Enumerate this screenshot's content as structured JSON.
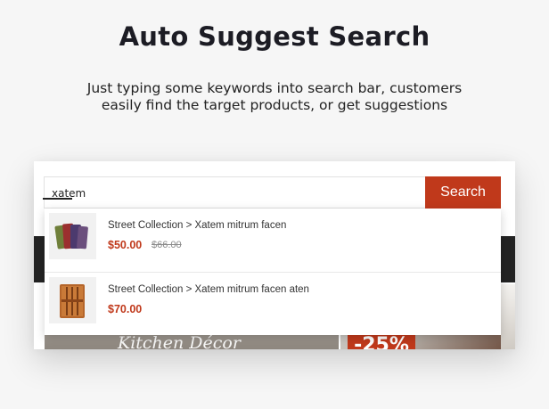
{
  "heading": "Auto Suggest Search",
  "description": "Just typing some keywords into search bar, customers easily find the target products, or get suggestions",
  "search": {
    "value": "xatem",
    "button_label": "Search"
  },
  "results": [
    {
      "name": "Street Collection > Xatem mitrum facen",
      "price": "$50.00",
      "old_price": "$66.00"
    },
    {
      "name": "Street Collection > Xatem mitrum facen aten",
      "price": "$70.00"
    }
  ],
  "background_page": {
    "banner_text": "Kitchen Décor",
    "promo_badge": "-25%"
  },
  "colors": {
    "accent": "#c0391b",
    "background": "#f6f6f6"
  },
  "icons": {
    "result_1": "cutting-boards-thumbnail",
    "result_2": "knife-block-thumbnail"
  }
}
